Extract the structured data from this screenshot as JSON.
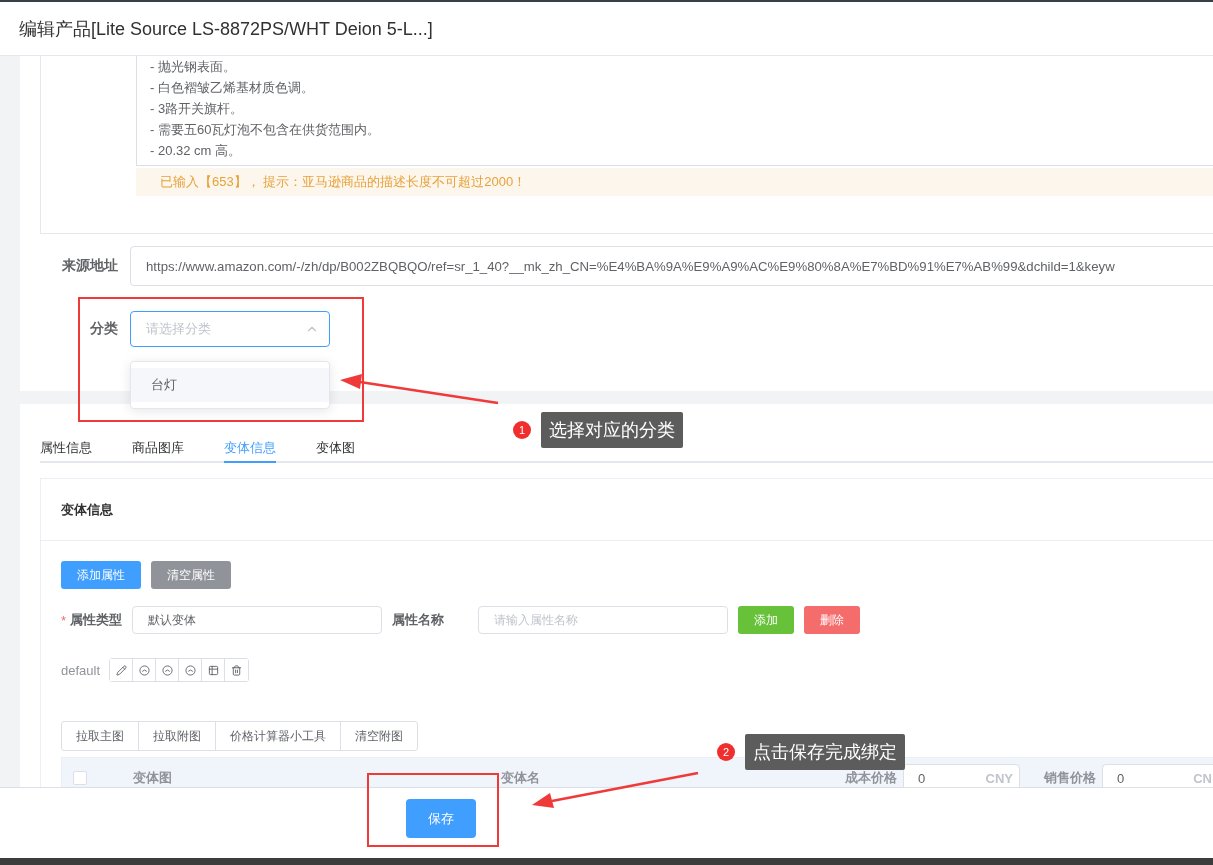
{
  "dialog": {
    "title": "编辑产品[Lite Source LS-8872PS/WHT Deion 5-L...]"
  },
  "description": {
    "lines": [
      "- 抛光钢表面。",
      "- 白色褶皱乙烯基材质色调。",
      "- 3路开关旗杆。",
      "- 需要五60瓦灯泡不包含在供货范围内。",
      "- 20.32 cm 高。"
    ],
    "notice": "已输入【653】， 提示：亚马逊商品的描述长度不可超过2000！"
  },
  "source": {
    "label": "来源地址",
    "value": "https://www.amazon.com/-/zh/dp/B002ZBQBQO/ref=sr_1_40?__mk_zh_CN=%E4%BA%9A%E9%A9%AC%E9%80%8A%E7%BD%91%E7%AB%99&dchild=1&keyw"
  },
  "category": {
    "label": "分类",
    "placeholder": "请选择分类",
    "expanded": true,
    "options": [
      {
        "label": "台灯",
        "highlighted": true
      }
    ]
  },
  "tabs": [
    {
      "label": "属性信息",
      "selected": false
    },
    {
      "label": "商品图库",
      "selected": false
    },
    {
      "label": "变体信息",
      "selected": true
    },
    {
      "label": "变体图",
      "selected": false
    }
  ],
  "variant_panel": {
    "title": "变体信息",
    "buttons": [
      {
        "label": "添加属性",
        "kind": "primary"
      },
      {
        "label": "清空属性",
        "kind": "neutral"
      }
    ],
    "attribute_type": {
      "required_mark": "*",
      "label": "属性类型",
      "value": "默认变体"
    },
    "attribute_name": {
      "label": "属性名称",
      "placeholder": "请输入属性名称"
    },
    "row_buttons": [
      {
        "label": "添加",
        "kind": "success"
      },
      {
        "label": "删除",
        "kind": "danger"
      }
    ],
    "default_label": "default",
    "tools": [
      "拉取主图",
      "拉取附图",
      "价格计算器小工具",
      "清空附图"
    ],
    "table_header": {
      "checked": false,
      "columns": [
        "变体图",
        "变体名"
      ],
      "cost": {
        "label": "成本价格",
        "value": "0",
        "unit": "CNY"
      },
      "price": {
        "label": "销售价格",
        "value": "0",
        "unit": "CN"
      }
    }
  },
  "footer": {
    "save": "保存"
  },
  "annotations": [
    {
      "number": "1",
      "text": "选择对应的分类"
    },
    {
      "number": "2",
      "text": "点击保存完成绑定"
    }
  ]
}
